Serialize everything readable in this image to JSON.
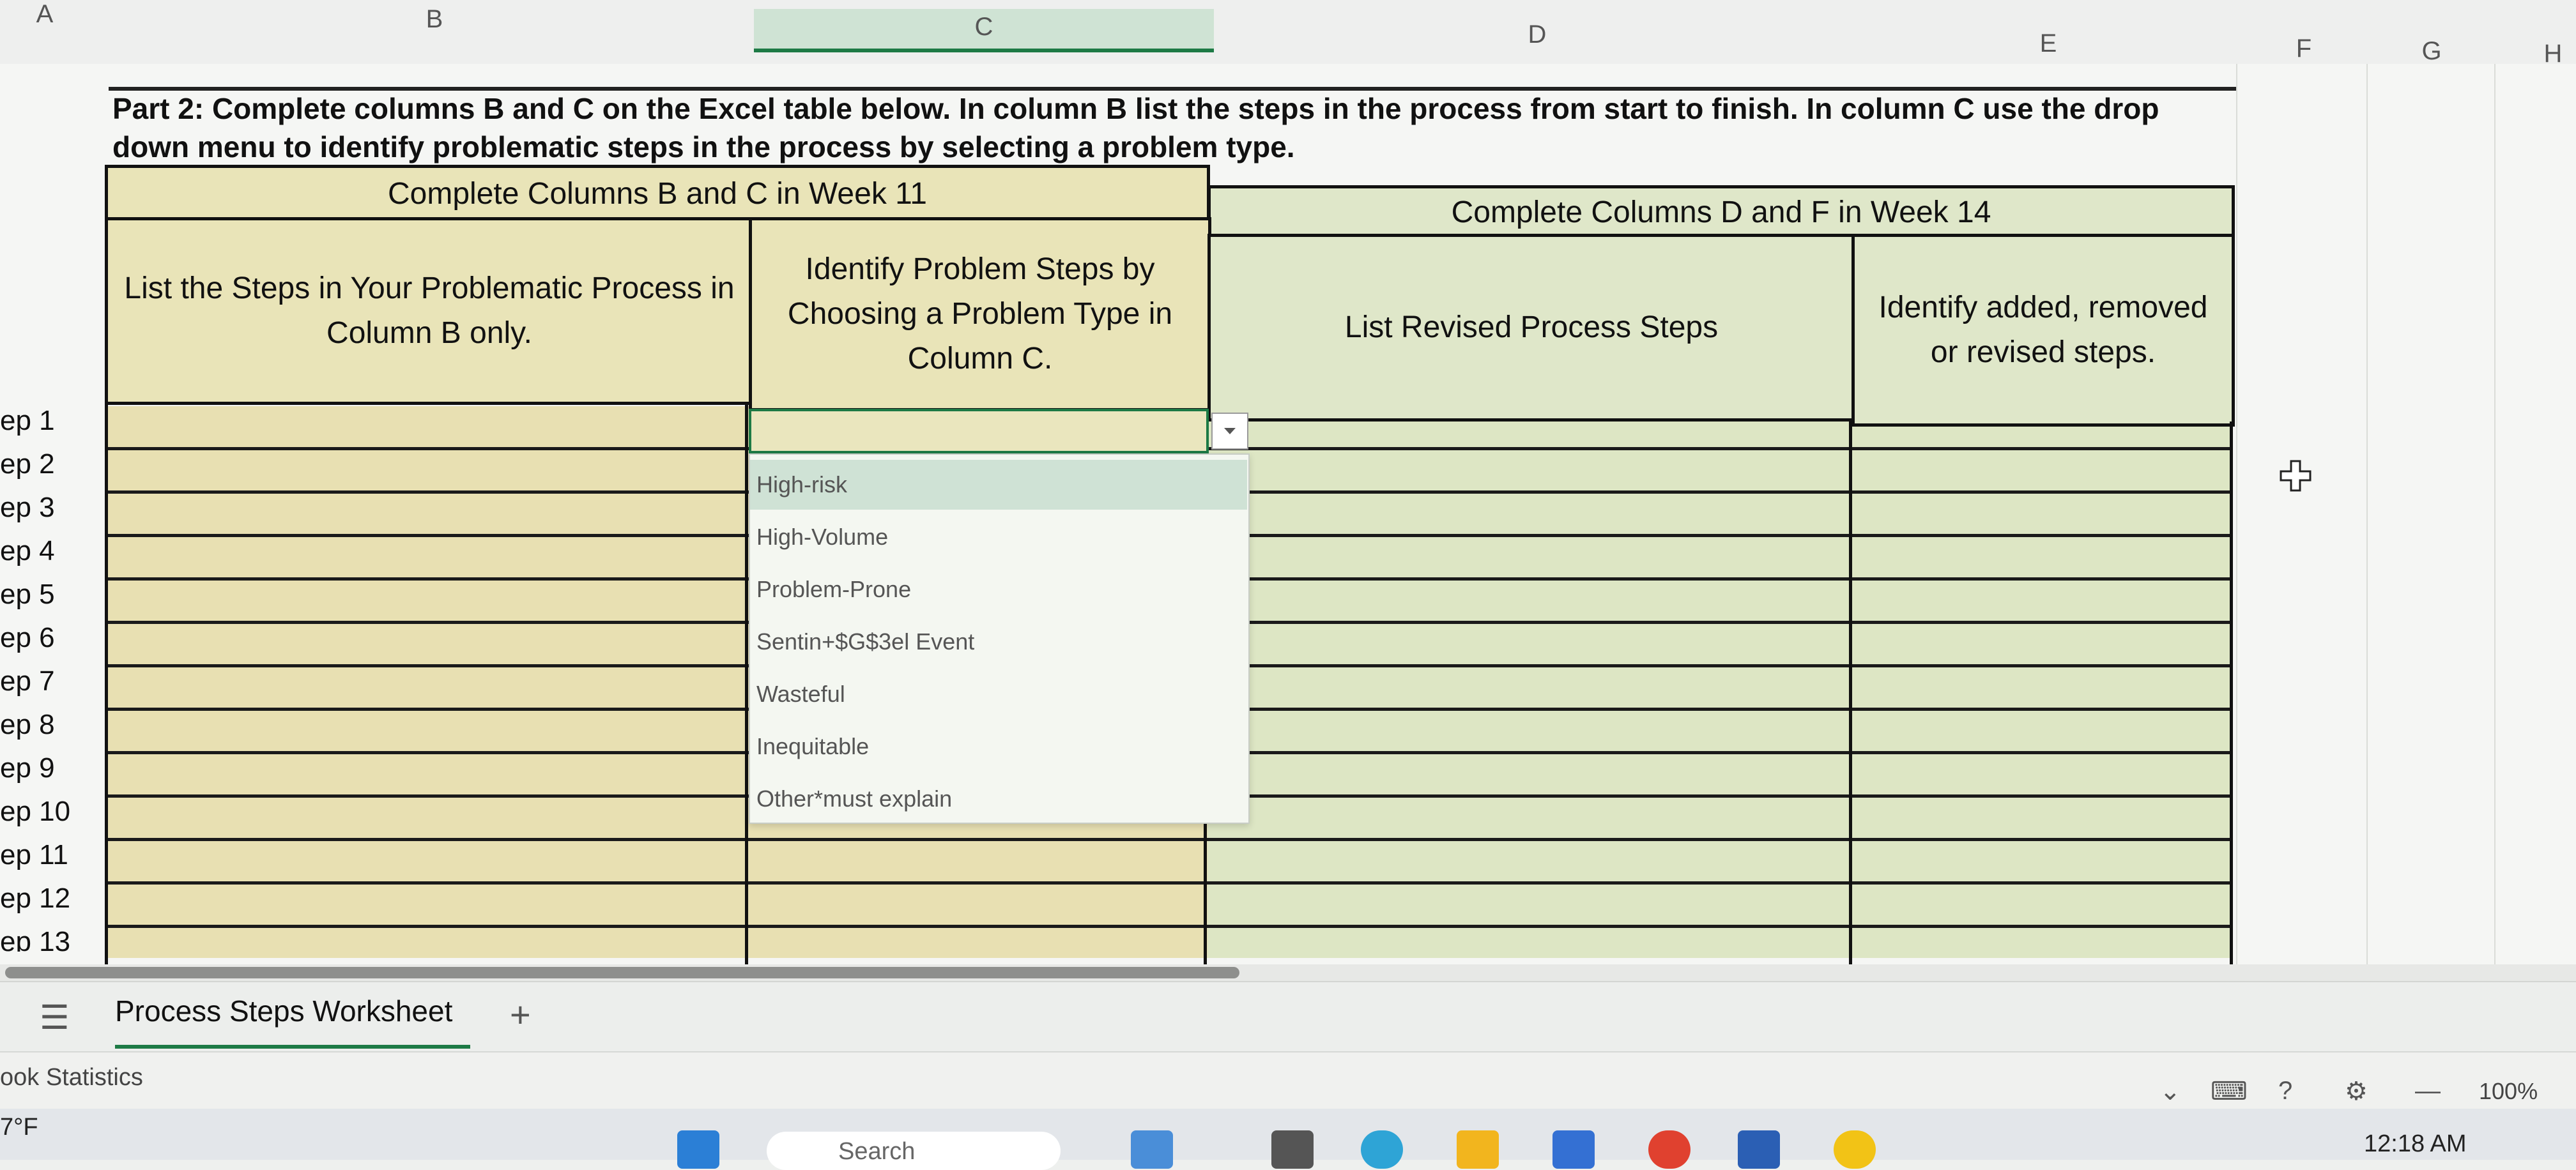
{
  "columns": [
    "A",
    "B",
    "C",
    "D",
    "E",
    "F",
    "G",
    "H"
  ],
  "instructions": {
    "line1": "Part 2: Complete columns B and C on the Excel table below.  In column B list the steps in the process from start to finish.  In column C use the drop",
    "line2": "down menu to identify problematic steps in the process by selecting a problem type."
  },
  "table": {
    "group_left": "Complete Columns B and C in Week 11",
    "group_right": "Complete Columns D and F in Week 14",
    "col_b": "List the Steps in Your Problematic Process in Column B only.",
    "col_c": "Identify Problem Steps by Choosing a Problem Type in Column C.",
    "col_d": "List Revised Process Steps",
    "col_e": "Identify added, removed or revised steps."
  },
  "row_labels": [
    "ep 1",
    "ep 2",
    "ep 3",
    "ep 4",
    "ep 5",
    "ep 6",
    "ep 7",
    "ep 8",
    "ep 9",
    "ep 10",
    "ep 11",
    "ep 12",
    "ep 13"
  ],
  "dropdown": {
    "options": [
      "High-risk",
      "High-Volume",
      "Problem-Prone",
      "Sentin+$G$3el Event",
      "Wasteful",
      "Inequitable",
      "Other*must explain"
    ],
    "highlighted": "High-risk"
  },
  "sheet_tab": "Process Steps Worksheet",
  "add_sheet": "+",
  "status": {
    "left": "ook Statistics",
    "zoom": "100%"
  },
  "taskbar": {
    "weather": "7°F",
    "search": "Search",
    "clock": "12:18 AM"
  },
  "colors": {
    "accent": "#1d7a45",
    "yellow_fill": "#e8e0b2",
    "green_fill": "#dde6c4"
  }
}
